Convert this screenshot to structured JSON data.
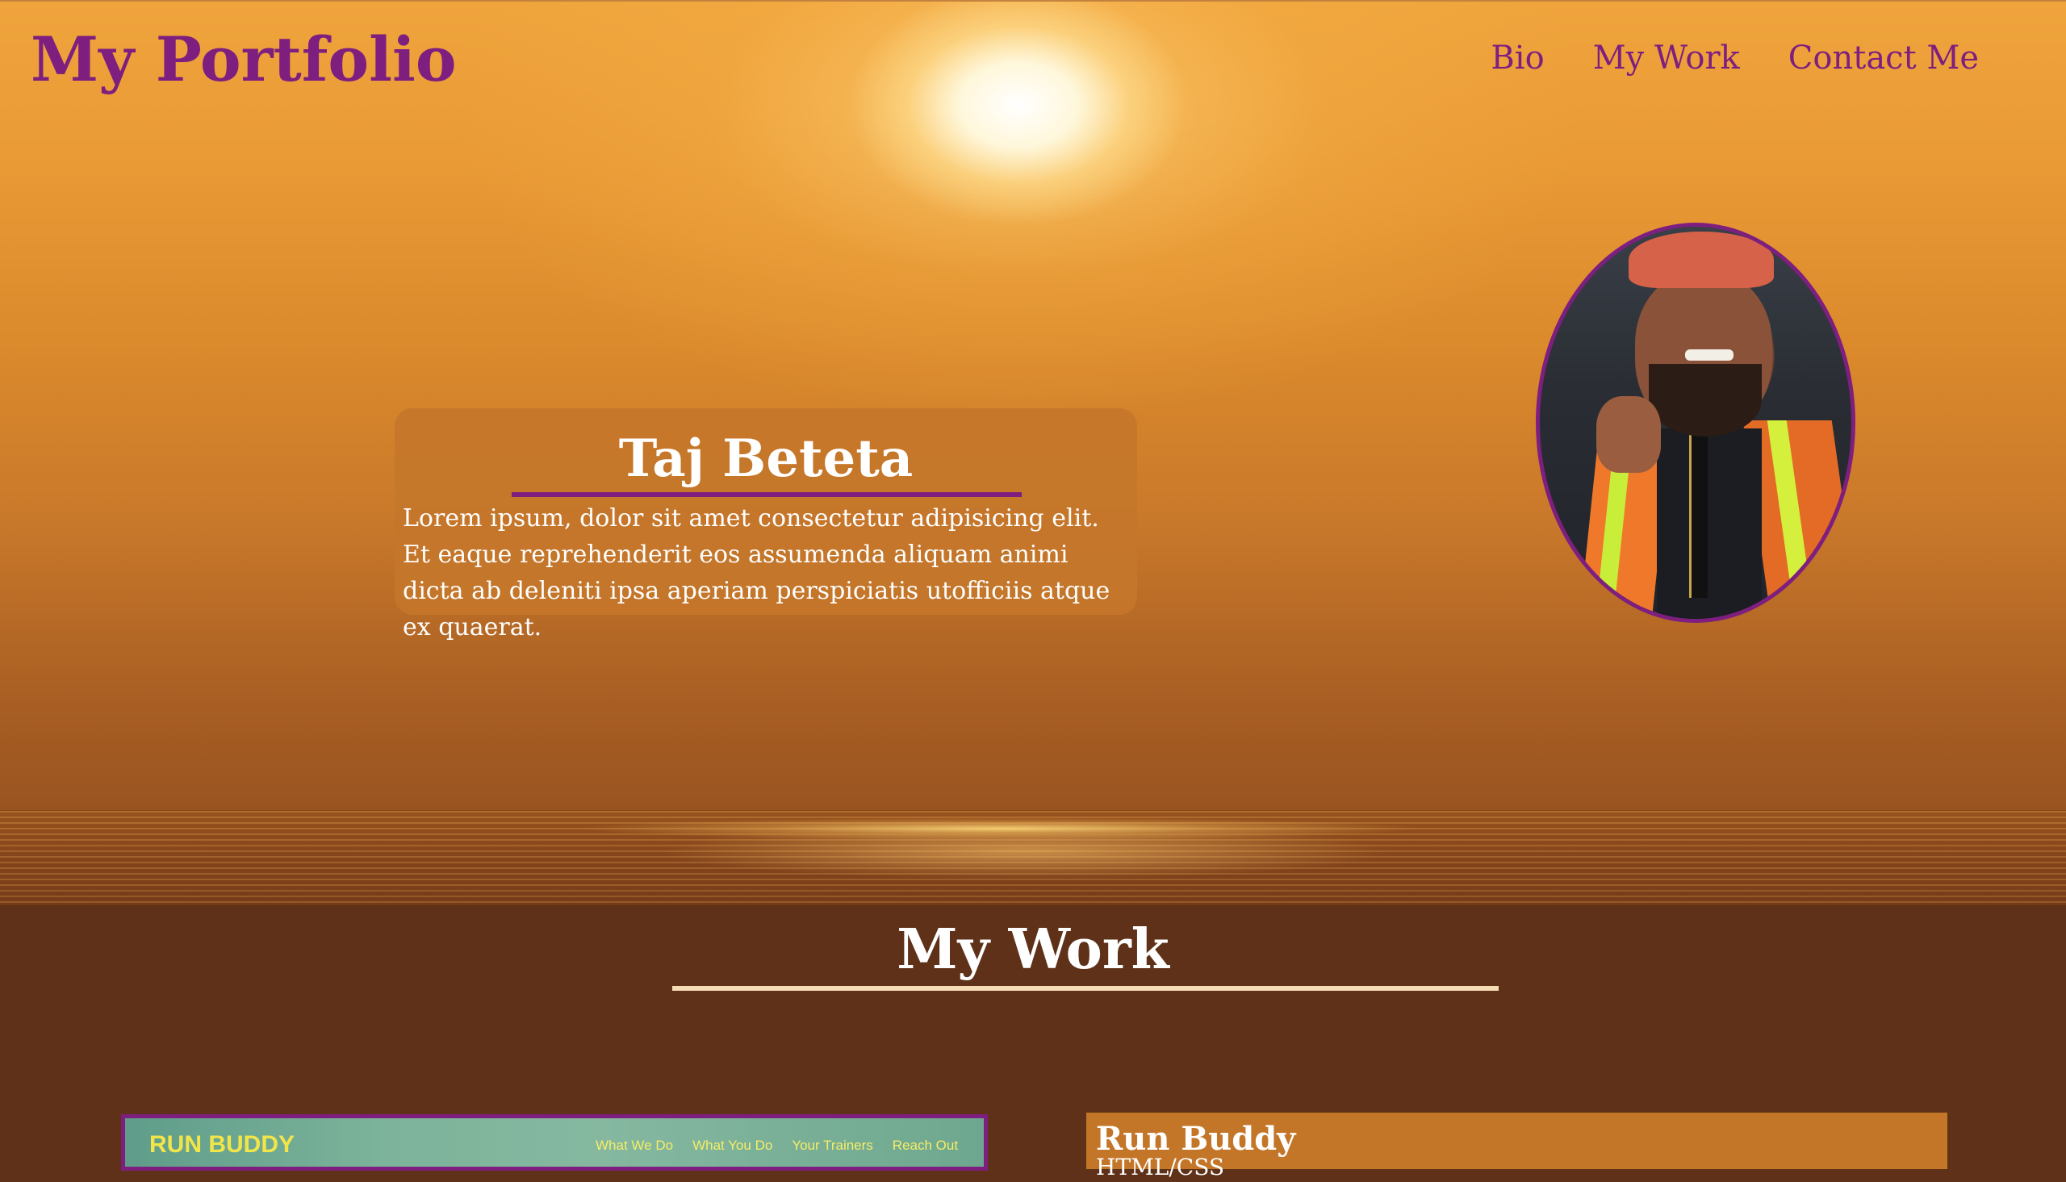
{
  "header": {
    "brand": "My Portfolio",
    "nav": [
      "Bio",
      "My Work",
      "Contact Me"
    ]
  },
  "bio": {
    "name": "Taj Beteta",
    "text": "Lorem ipsum, dolor sit amet consectetur adipisicing elit. Et eaque reprehenderit eos assumenda aliquam animi dicta ab deleniti ipsa aperiam perspiciatis utofficiis atque ex quaerat."
  },
  "work": {
    "title": "My Work",
    "projects": [
      {
        "name": "Run Buddy",
        "tech": "HTML/CSS",
        "thumb_brand": "RUN BUDDY",
        "thumb_nav": [
          "What We Do",
          "What You Do",
          "Your Trainers",
          "Reach Out"
        ]
      }
    ]
  },
  "colors": {
    "accent": "#7e1f80",
    "section_bg": "#5e3118",
    "card_bg": "#c47628",
    "underline_light": "#f6dcb5"
  },
  "icons": [
    "profile-photo"
  ]
}
